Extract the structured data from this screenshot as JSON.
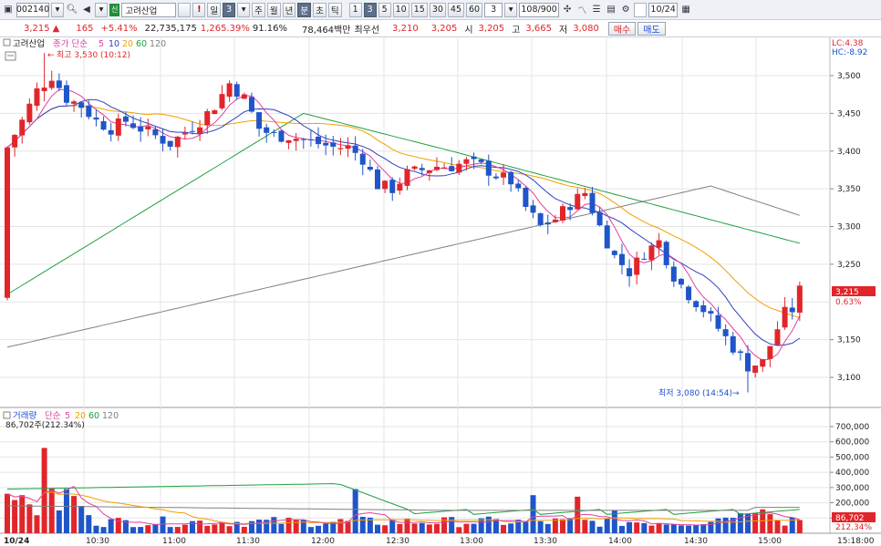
{
  "toolbar": {
    "code": "002140",
    "ticker_badge": "신",
    "name": "고려산업",
    "periods": [
      "일",
      "3",
      "주",
      "월",
      "년",
      "분",
      "초",
      "틱"
    ],
    "active_period_index": 1,
    "intervals": [
      "1",
      "3",
      "5",
      "10",
      "15",
      "30",
      "45",
      "60"
    ],
    "active_interval_index": 1,
    "interval_select": "3",
    "count": "108/900",
    "date": "10/24"
  },
  "quote": {
    "price": "3,215",
    "arrow": "▲",
    "change": "165",
    "change_pct": "+5.41%",
    "volume": "22,735,175",
    "volume_pct": "1,265.39%",
    "turnover": "91.16%",
    "amount": "78,464백만",
    "bid_label": "최우선",
    "bid1": "3,210",
    "bid2": "3,205",
    "open_label": "시",
    "open": "3,205",
    "high_label": "고",
    "high": "3,665",
    "low_label": "저",
    "low": "3,080",
    "buy_button": "매수",
    "sell_button": "매도"
  },
  "price_panel": {
    "title": "고려산업",
    "ma_label": "종가 단순",
    "ma_periods": [
      "5",
      "10",
      "20",
      "60",
      "120"
    ],
    "lc": "LC:4.38",
    "hc": "HC:-8.92",
    "max_annotation": "최고 3,530 (10:12)",
    "min_annotation": "최저 3,080 (14:54)",
    "last_price_tag": "3,215",
    "last_pct_tag": "0.63%",
    "y_ticks": [
      "3,500",
      "3,450",
      "3,400",
      "3,350",
      "3,300",
      "3,250",
      "3,150",
      "3,100"
    ]
  },
  "volume_panel": {
    "title": "거래량",
    "ma_label": "단순",
    "ma_periods": [
      "5",
      "20",
      "60",
      "120"
    ],
    "last_volume": "86,702주(212.34%)",
    "last_volume_tag": "86,702",
    "last_pct_tag": "212.34%",
    "y_ticks": [
      "700,000",
      "600,000",
      "500,000",
      "400,000",
      "300,000",
      "200,000",
      "100,000"
    ]
  },
  "x_axis": {
    "labels": [
      "10/24",
      "10:30",
      "11:00",
      "11:30",
      "12:00",
      "12:30",
      "13:00",
      "13:30",
      "14:00",
      "14:30",
      "15:00",
      "15:18:00"
    ]
  },
  "colors": {
    "up": "#e0262b",
    "down": "#1f55c8",
    "ma5": "#e040a0",
    "ma10": "#3040c0",
    "ma20": "#f0a000",
    "ma60": "#20a040",
    "ma120": "#808080"
  }
}
